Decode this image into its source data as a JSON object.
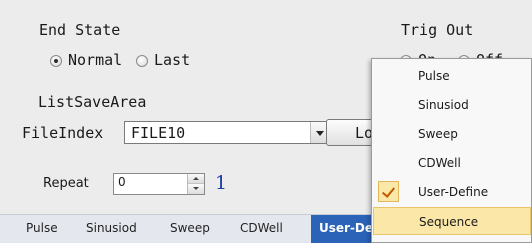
{
  "end_state": {
    "title": "End State",
    "options": [
      "Normal",
      "Last"
    ],
    "selected": "Normal"
  },
  "trig_out": {
    "title": "Trig Out",
    "options": [
      "On",
      "Off"
    ],
    "selected": "Off"
  },
  "list_save_area": {
    "label": "ListSaveArea",
    "file_index_label": "FileIndex",
    "file_index_value": "FILE10",
    "load_button": "Load"
  },
  "repeat": {
    "label": "Repeat",
    "value": "0",
    "annotation": "1"
  },
  "tabs": [
    {
      "label": "Pulse"
    },
    {
      "label": "Sinusiod"
    },
    {
      "label": "Sweep"
    },
    {
      "label": "CDWell"
    },
    {
      "label": "User-Define",
      "active": true
    }
  ],
  "menu": {
    "items": [
      {
        "label": "Pulse"
      },
      {
        "label": "Sinusiod"
      },
      {
        "label": "Sweep"
      },
      {
        "label": "CDWell"
      },
      {
        "label": "User-Define",
        "checked": true
      },
      {
        "label": "Sequence",
        "highlighted": true
      }
    ]
  },
  "colors": {
    "active_tab": "#2a63b8",
    "menu_highlight": "#fbe7a8",
    "annotation": "#1e3fa8"
  }
}
